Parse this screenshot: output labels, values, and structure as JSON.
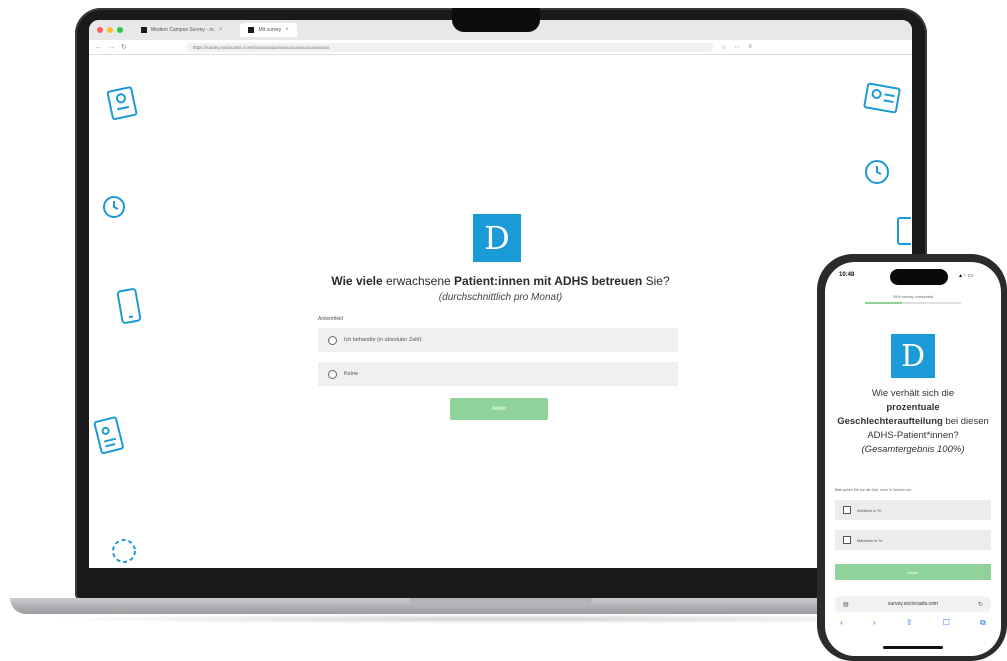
{
  "colors": {
    "brand": "#1a9ad6",
    "next_button": "#8fd29a",
    "laptop_frame": "#1a1a1c",
    "option_bg": "#f0f0f0"
  },
  "browser": {
    "tabs": [
      {
        "label": "Modern Campus Survey - rs.",
        "active": false
      },
      {
        "label": "Mit survey",
        "active": true
      }
    ],
    "url": "https://survey.sociocasts.com/s/xxxxxxxxxx/xxxxxxxxxxxxxxxxxxxxxx"
  },
  "survey": {
    "logo_letter": "D",
    "question_bold1": "Wie viele",
    "question_part2": " erwachsene ",
    "question_bold2": "Patient:innen mit ADHS betreuen",
    "question_part3": " Sie?",
    "question_sub": "(durchschnittlich pro Monat)",
    "answer_label": "Antwortfeld",
    "options": [
      {
        "label": "Ich behandle (in absoluter Zahl):"
      },
      {
        "label": "Keine"
      }
    ],
    "next_label": "Weiter"
  },
  "phone": {
    "time": "10:48",
    "status_icons": "▴ ◦ ▭",
    "progress_label": "39% survey completed",
    "progress": 0.39,
    "logo_letter": "D",
    "question_part1": "Wie verhält sich die",
    "question_bold": "prozentuale Geschlechteraufteilung",
    "question_part2": " bei diesen ADHS-Patient*innen? ",
    "question_italic": "(Gesamtergebnis 100%)",
    "hint": "Bitte geben Sie nur die Zahl, ohne % Zeichen ein.",
    "options": [
      {
        "label": "Weiblich in %:"
      },
      {
        "label": "Männlich in %:"
      }
    ],
    "next_label": "Weiter",
    "url": "survey.sociocasts.com",
    "toolbar": [
      "‹",
      "›",
      "⇪",
      "☐",
      "⧉"
    ]
  }
}
